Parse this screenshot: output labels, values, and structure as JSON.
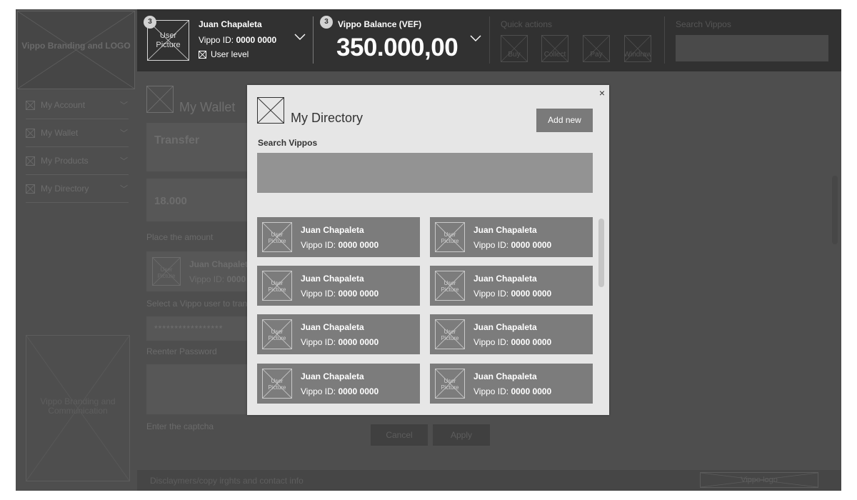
{
  "sidebar": {
    "branding_label": "Vippo Branding and LOGO",
    "items": [
      {
        "label": "My Account"
      },
      {
        "label": "My Wallet"
      },
      {
        "label": "My Products"
      },
      {
        "label": "My Directory"
      }
    ],
    "communication_label": "Vippo Branding and Communication"
  },
  "header": {
    "avatar_label": "User Picture",
    "user_badge": "3",
    "user_name": "Juan Chapaleta",
    "vippo_id_label": "Vippo ID:",
    "vippo_id_value": "0000 0000",
    "user_level_label": "User level",
    "balance_badge": "3",
    "balance_label": "Vippo Balance (VEF)",
    "balance_value": "350.000,00",
    "quick_actions_label": "Quick actions",
    "quick_actions": [
      {
        "label": "Buy"
      },
      {
        "label": "Collect"
      },
      {
        "label": "Pay"
      },
      {
        "label": "Windraw"
      }
    ],
    "search_label": "Search Vippos",
    "search_value": ""
  },
  "main": {
    "page_title": "My Wallet",
    "transfer_label": "Transfer",
    "amount_value": "18.000",
    "place_amount_label": "Place the amount",
    "selected_user": {
      "avatar_label": "User Picture",
      "name": "Juan Chapaleta",
      "id_label": "Vippo ID:",
      "id_value": "0000"
    },
    "select_user_label": "Select a Vippo user to tran",
    "password_value": "*****************",
    "reenter_password_label": "Reenter Password",
    "captcha_label": "Enter the captcha",
    "cancel_label": "Cancel",
    "apply_label": "Apply"
  },
  "footer": {
    "disclaimer": "Disclaymers/copy irghts and contact info",
    "logo_label": "Vippo logo"
  },
  "modal": {
    "close_glyph": "×",
    "title": "My Directory",
    "add_new_label": "Add new",
    "search_label": "Search Vippos",
    "search_value": "",
    "contacts": [
      {
        "avatar_label": "User Picture",
        "name": "Juan Chapaleta",
        "id_label": "Vippo ID:",
        "id_value": "0000 0000"
      },
      {
        "avatar_label": "User Picture",
        "name": "Juan Chapaleta",
        "id_label": "Vippo ID:",
        "id_value": "0000 0000"
      },
      {
        "avatar_label": "User Picture",
        "name": "Juan Chapaleta",
        "id_label": "Vippo ID:",
        "id_value": "0000 0000"
      },
      {
        "avatar_label": "User Picture",
        "name": "Juan Chapaleta",
        "id_label": "Vippo ID:",
        "id_value": "0000 0000"
      },
      {
        "avatar_label": "User Picture",
        "name": "Juan Chapaleta",
        "id_label": "Vippo ID:",
        "id_value": "0000 0000"
      },
      {
        "avatar_label": "User Picture",
        "name": "Juan Chapaleta",
        "id_label": "Vippo ID:",
        "id_value": "0000 0000"
      },
      {
        "avatar_label": "User Picture",
        "name": "Juan Chapaleta",
        "id_label": "Vippo ID:",
        "id_value": "0000 0000"
      },
      {
        "avatar_label": "User Picture",
        "name": "Juan Chapaleta",
        "id_label": "Vippo ID:",
        "id_value": "0000 0000"
      }
    ]
  }
}
